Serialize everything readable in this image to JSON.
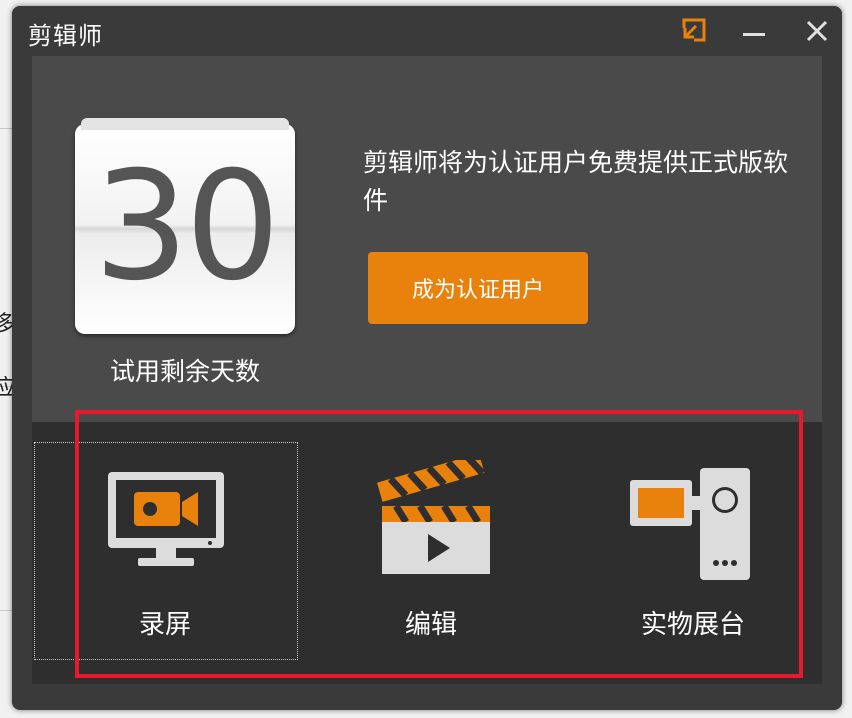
{
  "window": {
    "title": "剪辑师"
  },
  "background": {
    "chars": [
      "多",
      "应"
    ]
  },
  "trial": {
    "days_left": "30",
    "caption": "试用剩余天数"
  },
  "promo": {
    "text": "剪辑师将为认证用户免费提供正式版软件",
    "button_label": "成为认证用户"
  },
  "tools": [
    {
      "label": "录屏",
      "icon": "screen-record-icon"
    },
    {
      "label": "编辑",
      "icon": "clapperboard-icon"
    },
    {
      "label": "实物展台",
      "icon": "document-camera-icon"
    }
  ],
  "colors": {
    "accent": "#E8820C",
    "highlight": "#E8192C",
    "window_bg": "#3A3A3A",
    "top_panel_bg": "#4A4A4A",
    "bottom_panel_bg": "#2E2E2E"
  }
}
